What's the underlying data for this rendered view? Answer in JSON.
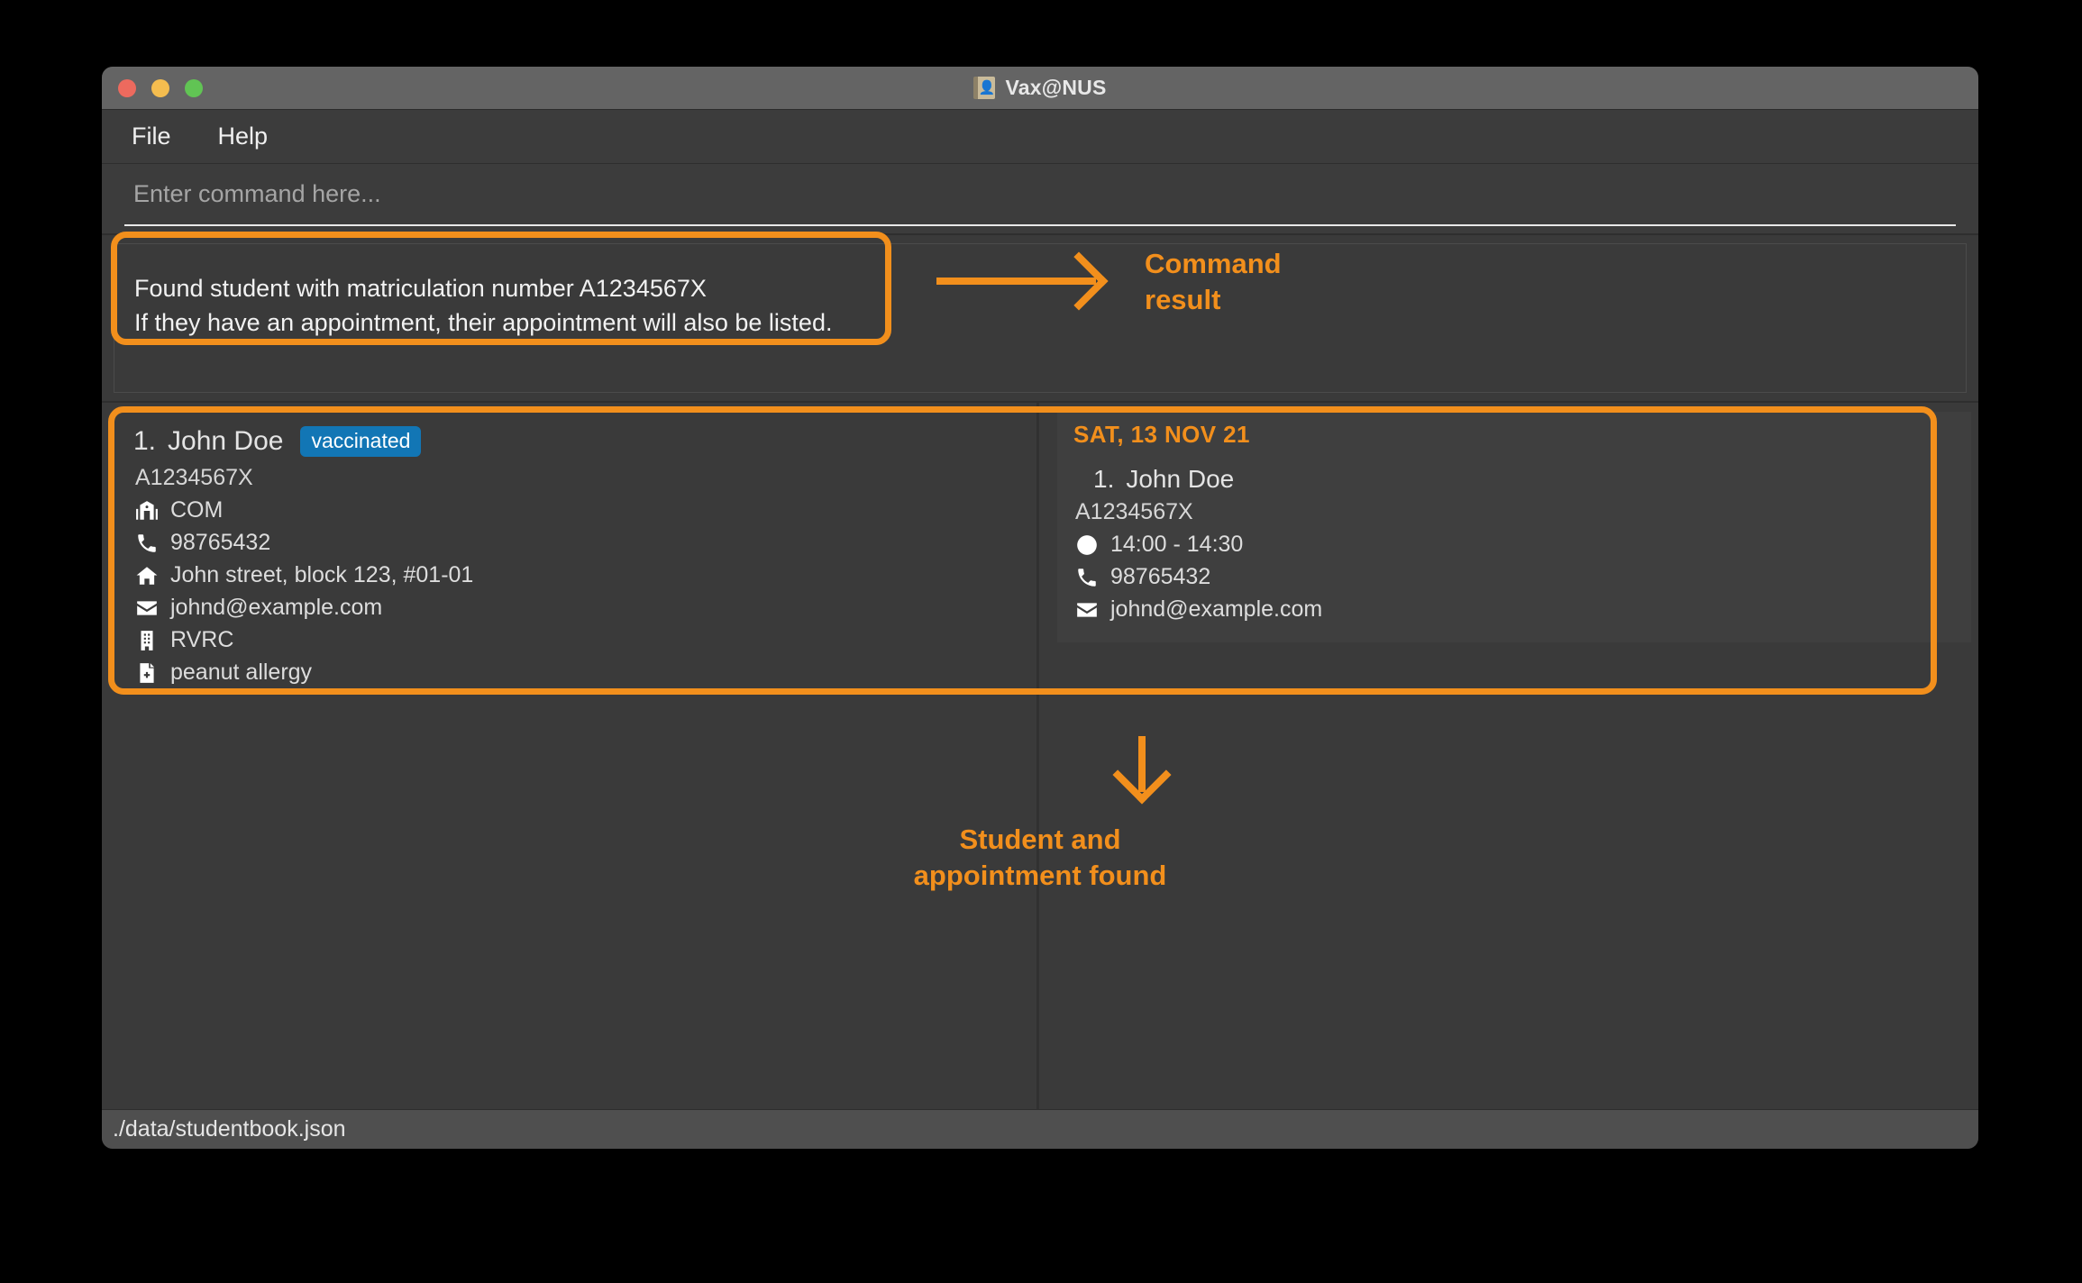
{
  "window": {
    "title": "Vax@NUS",
    "title_icon": "address-book-icon",
    "traffic_lights": {
      "close": "close-button",
      "minimize": "minimize-button",
      "zoom": "zoom-button"
    }
  },
  "menubar": {
    "items": [
      {
        "label": "File"
      },
      {
        "label": "Help"
      }
    ]
  },
  "command": {
    "placeholder": "Enter command here...",
    "value": ""
  },
  "result": {
    "text": "Found student with matriculation number A1234567X\nIf they have an appointment, their appointment will also be listed."
  },
  "annotations": {
    "command_result": "Command\nresult",
    "student_appointment": "Student and\nappointment found"
  },
  "student_list": [
    {
      "index": "1.",
      "name": "John Doe",
      "status_badge": "vaccinated",
      "matric": "A1234567X",
      "details": [
        {
          "icon": "school-icon",
          "value": "COM"
        },
        {
          "icon": "phone-icon",
          "value": "98765432"
        },
        {
          "icon": "home-icon",
          "value": "John street, block 123, #01-01"
        },
        {
          "icon": "email-icon",
          "value": "johnd@example.com"
        },
        {
          "icon": "building-icon",
          "value": "RVRC"
        },
        {
          "icon": "medical-icon",
          "value": "peanut allergy"
        }
      ]
    }
  ],
  "appointment_list": [
    {
      "date": "SAT, 13 NOV 21",
      "index": "1.",
      "name": "John Doe",
      "matric": "A1234567X",
      "details": [
        {
          "icon": "clock-icon",
          "value": "14:00 - 14:30"
        },
        {
          "icon": "phone-icon",
          "value": "98765432"
        },
        {
          "icon": "email-icon",
          "value": "johnd@example.com"
        }
      ]
    }
  ],
  "statusbar": {
    "path": "./data/studentbook.json"
  },
  "colors": {
    "accent_orange": "#f28f1c",
    "badge_blue": "#1276b5",
    "window_bg": "#3a3a3a",
    "titlebar_bg": "#646464",
    "statusbar_bg": "#4f4f4f"
  }
}
